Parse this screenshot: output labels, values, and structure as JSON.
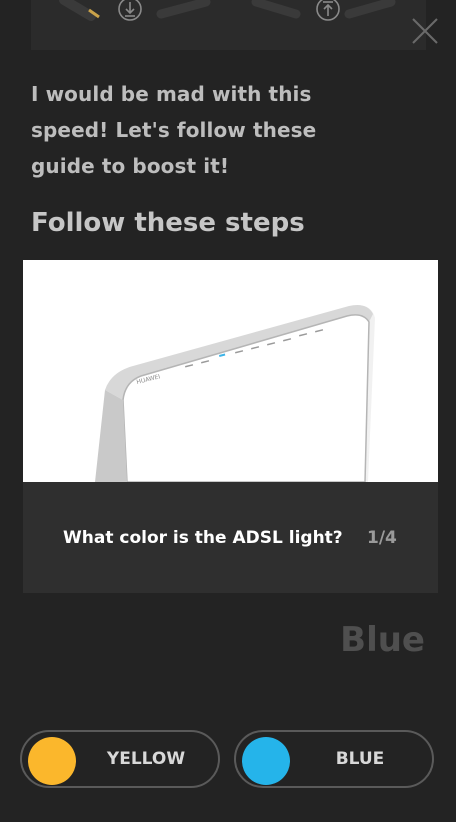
{
  "intro_text": "I would be mad with this speed! Let's follow these guide to boost it!",
  "steps_title": "Follow these steps",
  "step": {
    "question": "What color is the ADSL light?",
    "counter": "1/4",
    "image": "router-photo"
  },
  "answer": "Blue",
  "options": [
    {
      "label": "YELLOW",
      "color": "#fbb72c"
    },
    {
      "label": "BLUE",
      "color": "#25b4ea"
    }
  ],
  "colors": {
    "background": "#232323",
    "card": "#2f2f2f",
    "text": "#bdbdbd"
  }
}
